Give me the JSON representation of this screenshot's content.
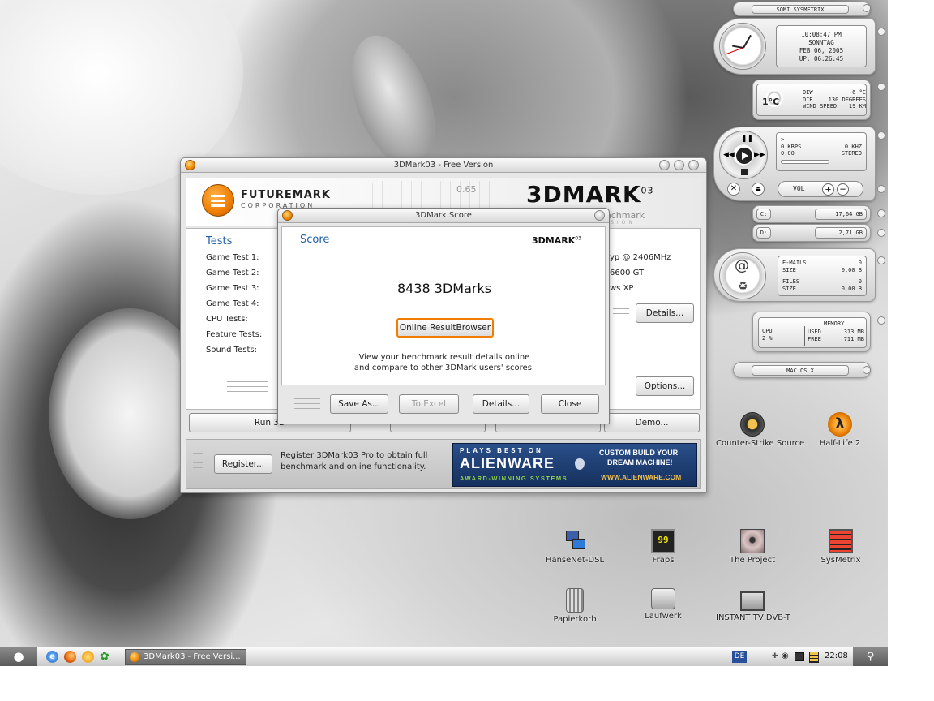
{
  "main_window": {
    "title": "3DMark03 - Free Version",
    "brand_name": "FUTUREMARK",
    "brand_sub": "CORPORATION",
    "product": "3DMARK",
    "product_sup": "03",
    "tagline": "The Gamers' Benchmark",
    "tagline_sub": "VERSION",
    "graph_value": "0.65",
    "tests_heading": "Tests",
    "tests": [
      "Game Test 1:",
      "Game Test 2:",
      "Game Test 3:",
      "Game Test 4:",
      "CPU Tests:",
      "Feature Tests:",
      "Sound Tests:"
    ],
    "system_info": [
      "yp @ 2406MHz",
      "6600 GT",
      "ws XP"
    ],
    "details_label": "Details...",
    "options_label": "Options...",
    "run_label": "Run 3D",
    "demo_label": "Demo...",
    "register_label": "Register...",
    "register_text_1": "Register 3DMark03 Pro to obtain full",
    "register_text_2": "benchmark and online functionality.",
    "ad": {
      "top": "PLAYS BEST ON",
      "brand": "ALIENWARE",
      "bottom": "AWARD-WINNING SYSTEMS",
      "custom_1": "CUSTOM BUILD YOUR",
      "custom_2": "DREAM MACHINE!",
      "url": "WWW.ALIENWARE.COM"
    }
  },
  "score_dialog": {
    "title": "3DMark Score",
    "heading": "Score",
    "logo": "3DMARK",
    "logo_sup": "03",
    "score_text": "8438 3DMarks",
    "online_button": "Online ResultBrowser",
    "desc_1": "View your benchmark result details online",
    "desc_2": "and compare to other 3DMark users' scores.",
    "buttons": {
      "save": "Save As...",
      "excel": "To Excel",
      "details": "Details...",
      "close": "Close"
    }
  },
  "widget": {
    "title": "SOMI SYSMETRIX",
    "time": "10:08:47 PM",
    "day": "SONNTAG",
    "date": "FEB 06, 2005",
    "uptime": "UP: 06:26:45",
    "temp": "1°C",
    "dew_label": "DEW",
    "dew_value": "-6 °C",
    "dir_label": "DIR",
    "dir_value": "130 DEGREES",
    "wind_label": "WIND SPEED",
    "wind_value": "19 KM",
    "player_line": ">",
    "kbps": "0 KBPS",
    "khz": "0 KHZ",
    "time_code": "0:00",
    "stereo": "STEREO",
    "vol_label": "VOL",
    "drive_c_label": "C:",
    "drive_c_value": "17,64 GB",
    "drive_d_label": "D:",
    "drive_d_value": "2,71 GB",
    "emails_label": "E-MAILS",
    "emails_value": "0",
    "emails_size_label": "SIZE",
    "emails_size_value": "0,00 B",
    "files_label": "FILES",
    "files_value": "0",
    "files_size_label": "SIZE",
    "files_size_value": "0,00 B",
    "cpu_label": "CPU",
    "cpu_value": "2 %",
    "memory_label": "MEMORY",
    "mem_used_label": "USED",
    "mem_used_value": "313 MB",
    "mem_free_label": "FREE",
    "mem_free_value": "711 MB",
    "footer": "MAC OS X"
  },
  "desktop_icons": {
    "counter_strike": "Counter-Strike Source",
    "half_life": "Half-Life 2",
    "hansenet": "HanseNet-DSL",
    "fraps": "Fraps",
    "the_project": "The Project",
    "sysmetrix": "SysMetrix",
    "papierkorb": "Papierkorb",
    "laufwerk": "Laufwerk",
    "instant_tv": "INSTANT TV DVB-T"
  },
  "taskbar": {
    "task_label": "3DMark03 - Free Versi...",
    "lang": "DE",
    "clock": "22:08"
  },
  "colors": {
    "accent_orange": "#f07d00",
    "heading_blue": "#1f5fa8",
    "ad_blue": "#1b3a6b"
  }
}
